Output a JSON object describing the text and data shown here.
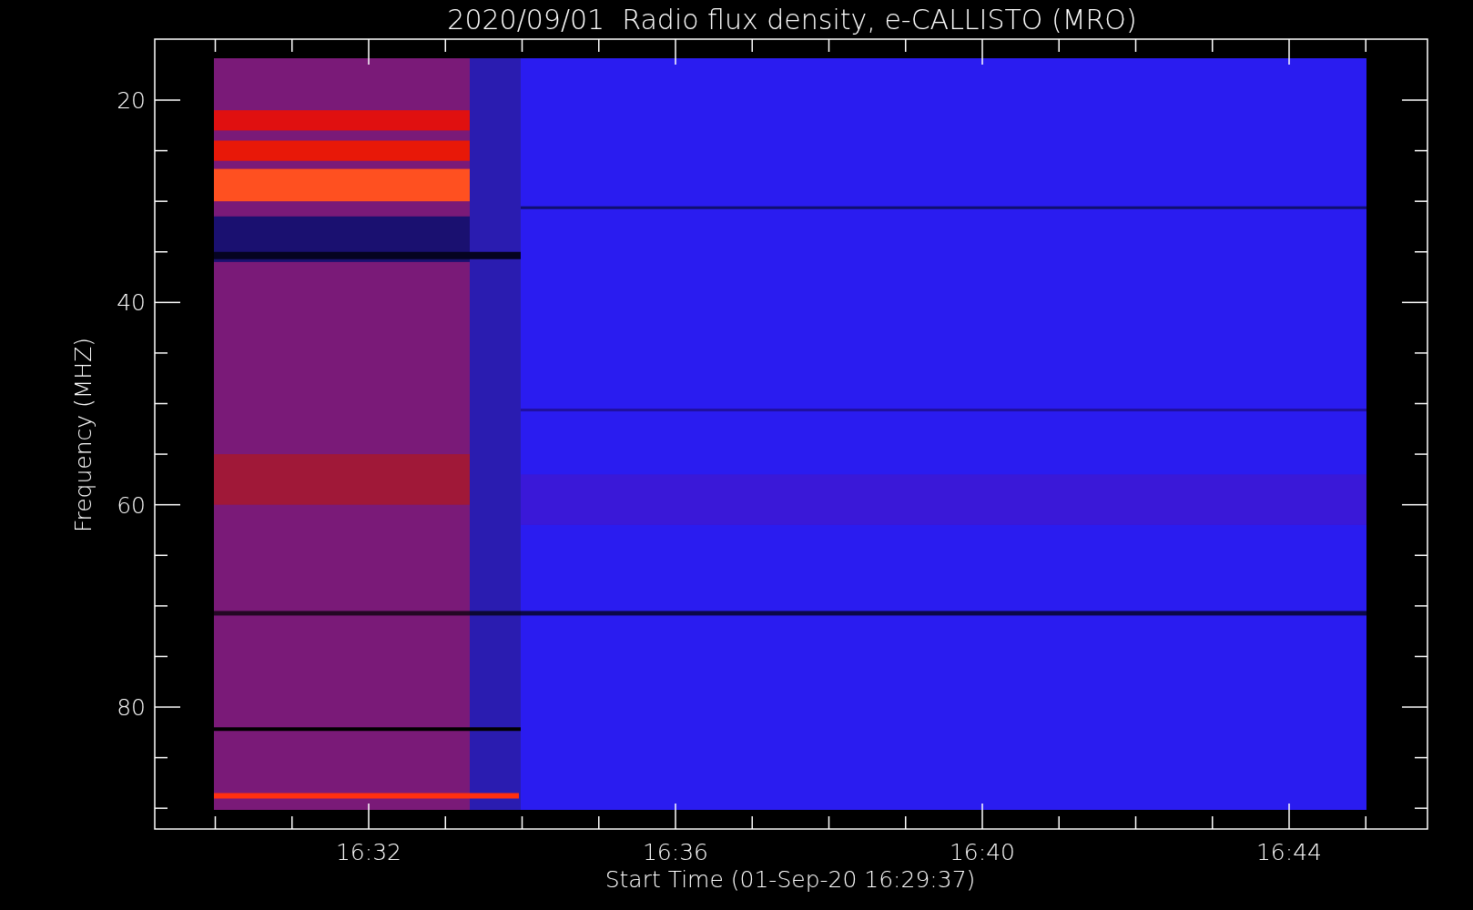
{
  "title": "2020/09/01  Radio flux density, e-CALLISTO (MRO)",
  "ylabel": "Frequency (MHZ)",
  "xlabel": "Start Time (01-Sep-20 16:29:37)",
  "yticks": [
    "20",
    "40",
    "60",
    "80"
  ],
  "xticks": [
    "16:32",
    "16:36",
    "16:40",
    "16:44"
  ]
}
